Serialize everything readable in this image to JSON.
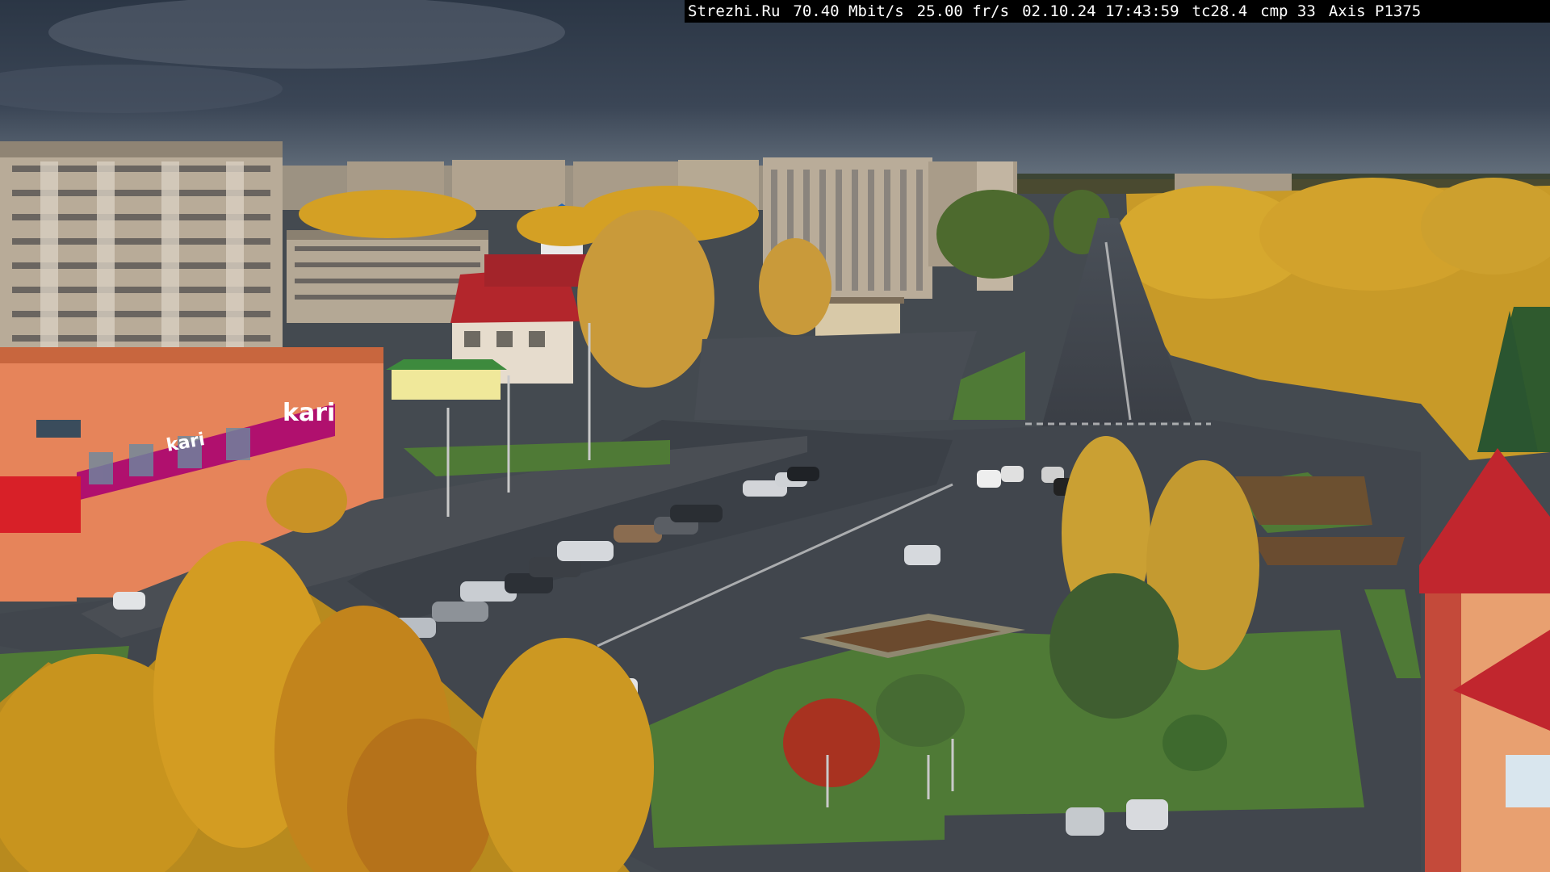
{
  "overlay": {
    "site": "Strezhi.Ru",
    "bitrate": "70.40 Mbit/s",
    "framerate": "25.00 fr/s",
    "datetime": "02.10.24 17:43:59",
    "tc": "tc28.4",
    "cmp": "cmp 33",
    "camera": "Axis P1375"
  },
  "signs": {
    "store_main": "kari",
    "store_facade": "kari"
  },
  "colors": {
    "sky_top": "#2b3645",
    "sky_horizon": "#6e7a86",
    "foliage_gold": "#d4a024",
    "foliage_orange": "#c77a1e",
    "asphalt": "#3f444c",
    "grass": "#4f7a36",
    "kari_magenta": "#b0106e",
    "building_panel": "#b8ab98",
    "roof_red": "#b3262c"
  }
}
